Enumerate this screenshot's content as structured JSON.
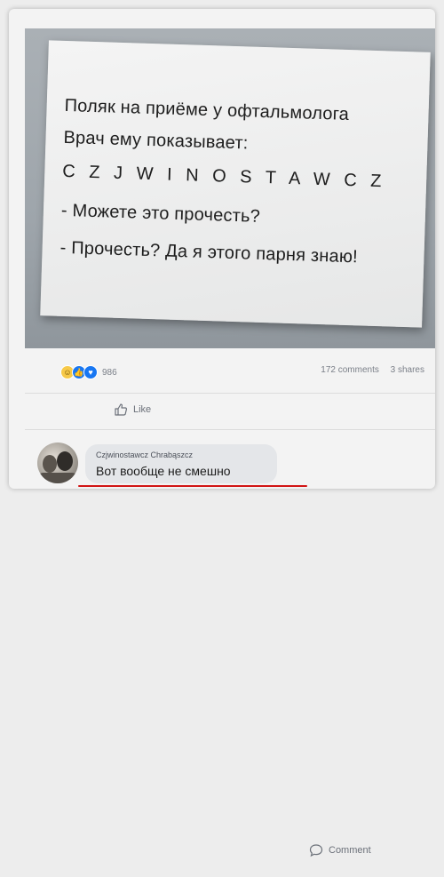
{
  "note": {
    "line1": "Поляк на приёме у офтальмолога",
    "line2": "Врач ему показывает:",
    "line3": "C Z J W I N O S T A W C Z",
    "line4": "- Можете это прочесть?",
    "line5": "- Прочесть? Да я этого парня знаю!"
  },
  "stats": {
    "reaction_count": "986",
    "comments": "172 comments",
    "shares": "3 shares",
    "reaction_icons": [
      "haha-icon",
      "like-icon",
      "love-icon"
    ]
  },
  "actions": {
    "like_label": "Like",
    "comment_label": "Comment"
  },
  "comment": {
    "author": "Czjwinostawcz Chrabąszcz",
    "text": "Вот вообще не смешно"
  },
  "colors": {
    "accent": "#1877f2",
    "underline": "#d11414"
  }
}
